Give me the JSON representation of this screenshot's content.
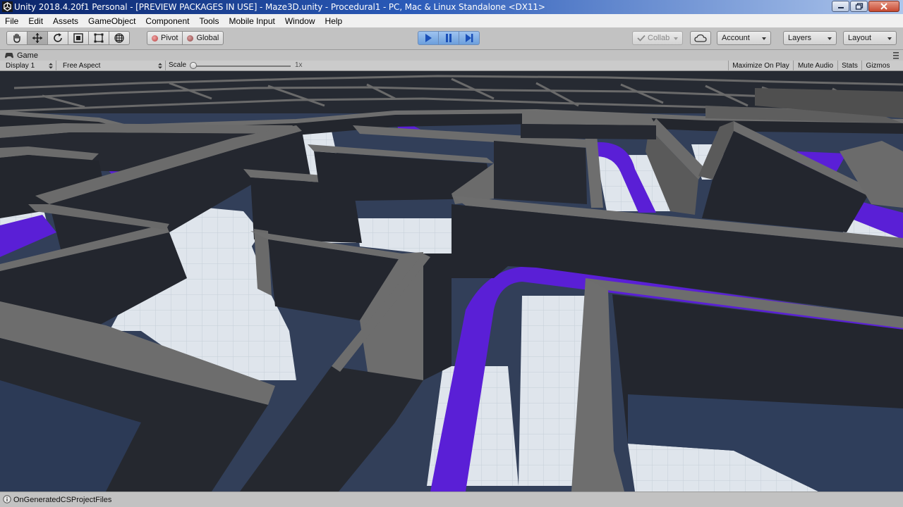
{
  "window": {
    "title": "Unity 2018.4.20f1 Personal - [PREVIEW PACKAGES IN USE] - Maze3D.unity - Procedural1 - PC, Mac & Linux Standalone <DX11>"
  },
  "menu": {
    "items": [
      "File",
      "Edit",
      "Assets",
      "GameObject",
      "Component",
      "Tools",
      "Mobile Input",
      "Window",
      "Help"
    ]
  },
  "toolbar": {
    "transform_tools": [
      "hand-icon",
      "move-icon",
      "rotate-icon",
      "scale-icon",
      "rect-tool-icon",
      "transform-tool-icon"
    ],
    "pivot_label": "Pivot",
    "global_label": "Global",
    "playback": [
      "play-icon",
      "pause-icon",
      "step-icon"
    ],
    "collab_label": "Collab",
    "account_label": "Account",
    "layers_label": "Layers",
    "layout_label": "Layout"
  },
  "game_view": {
    "tab_label": "Game",
    "display": "Display 1",
    "aspect": "Free Aspect",
    "scale_label": "Scale",
    "scale_value": "1x",
    "toggles": [
      "Maximize On Play",
      "Mute Audio",
      "Stats",
      "Gizmos"
    ]
  },
  "status": {
    "message": "OnGeneratedCSProjectFiles"
  },
  "colors": {
    "path_purple": "#5a1fd6",
    "wall_top": "#6e6e6e",
    "wall_face": "#24272f",
    "floor": "#d8dee6",
    "play_active": "#6c9fdc"
  }
}
